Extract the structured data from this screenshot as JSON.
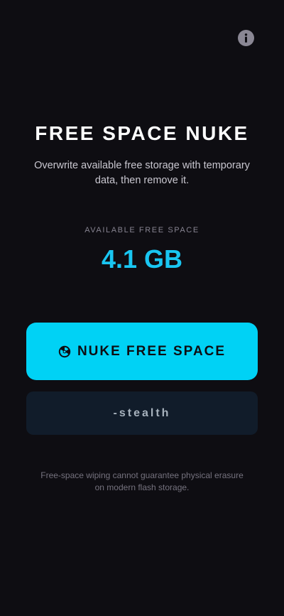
{
  "header": {
    "info_icon": "info-icon"
  },
  "hero": {
    "title": "FREE SPACE NUKE",
    "subtitle": "Overwrite available free storage with temporary data, then remove it."
  },
  "storage": {
    "label": "AVAILABLE FREE SPACE",
    "value": "4.1 GB"
  },
  "actions": {
    "nuke_icon": "radiation-icon",
    "nuke_label": "NUKE FREE SPACE",
    "stealth_label": "-stealth"
  },
  "footer": {
    "disclaimer": "Free-space wiping cannot guarantee physical erasure on modern flash storage."
  },
  "colors": {
    "background": "#0e0d12",
    "accent": "#00d2f5",
    "value_text": "#19c6f2",
    "secondary_button": "#111c2a"
  }
}
